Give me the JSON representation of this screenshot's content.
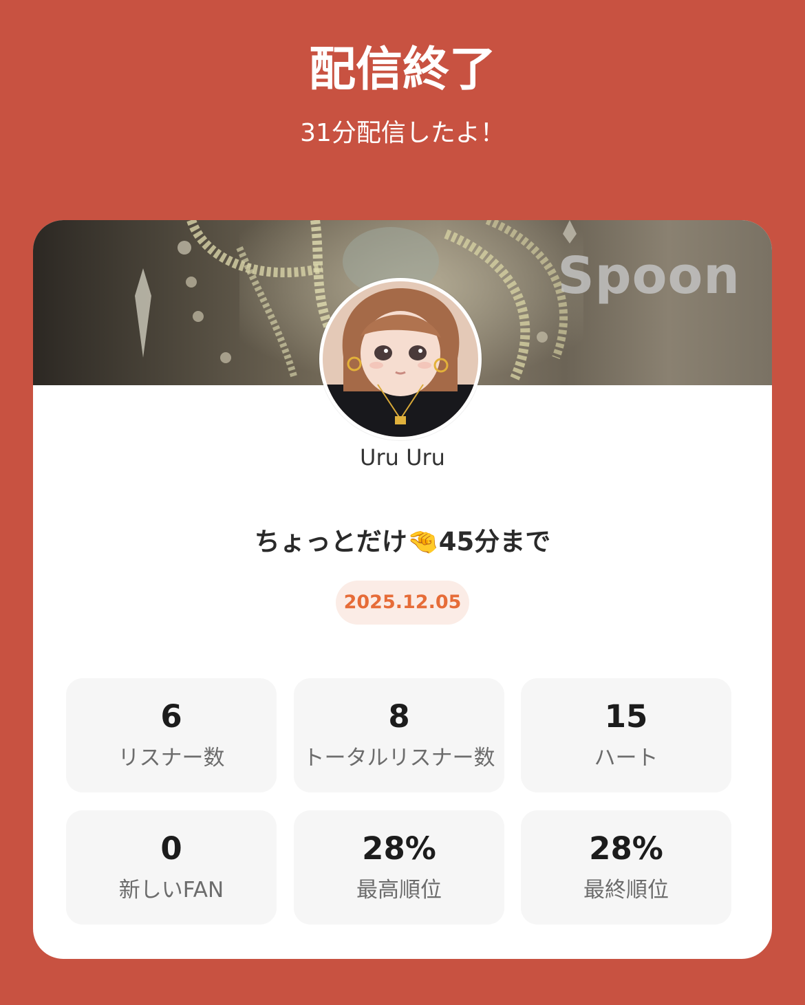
{
  "header": {
    "title": "配信終了",
    "subtitle": "31分配信したよ！"
  },
  "card": {
    "brand": "Spoon",
    "username": "Uru Uru",
    "stream_title": "ちょっとだけ🤏45分まで",
    "date": "2025.12.05"
  },
  "stats": [
    {
      "value": "6",
      "label": "リスナー数"
    },
    {
      "value": "8",
      "label": "トータルリスナー数"
    },
    {
      "value": "15",
      "label": "ハート"
    },
    {
      "value": "0",
      "label": "新しいFAN"
    },
    {
      "value": "28%",
      "label": "最高順位"
    },
    {
      "value": "28%",
      "label": "最終順位"
    }
  ],
  "colors": {
    "background": "#c85241",
    "date_text": "#e66c38",
    "date_pill": "#fbece6",
    "stat_tile": "#f6f6f6"
  }
}
